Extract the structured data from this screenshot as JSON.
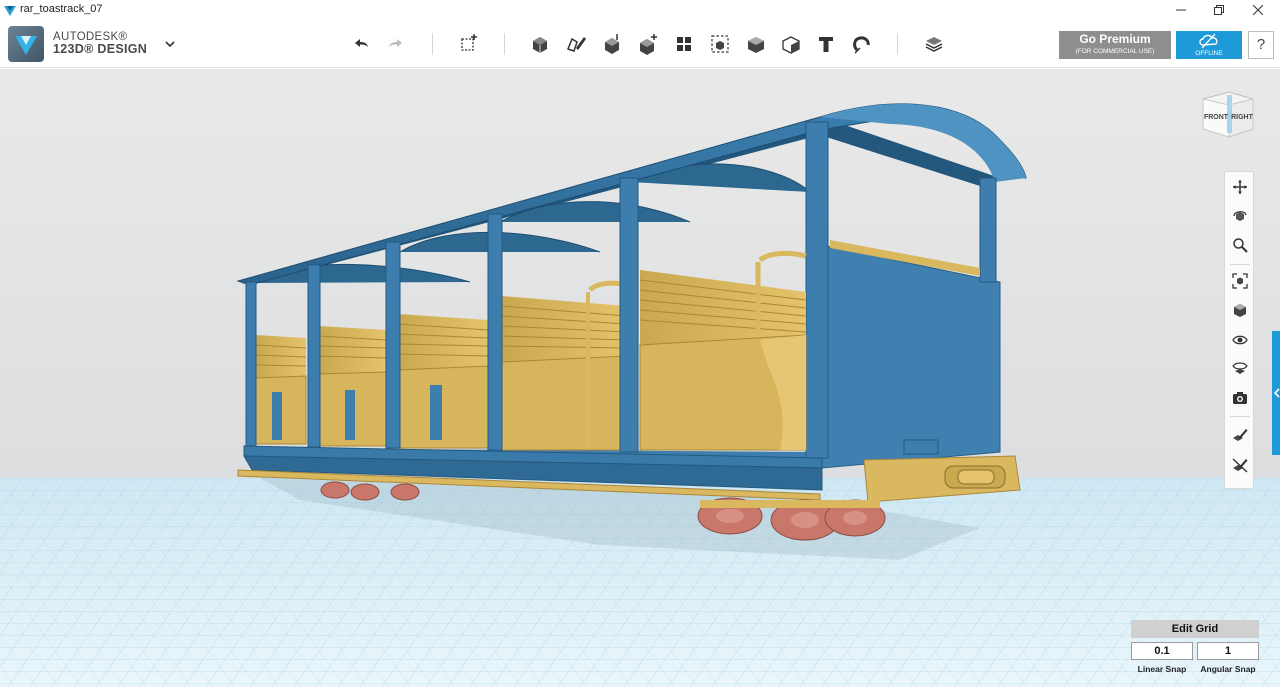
{
  "window": {
    "title": "rar_toastrack_07",
    "controls": [
      "minimize",
      "maximize",
      "close"
    ]
  },
  "app": {
    "brand_line1": "AUTODESK®",
    "brand_line2": "123D® DESIGN"
  },
  "toolbar": {
    "tools": [
      {
        "name": "undo-icon"
      },
      {
        "name": "redo-icon"
      },
      {
        "name": "transform-icon"
      },
      {
        "name": "primitives-icon"
      },
      {
        "name": "sketch-icon"
      },
      {
        "name": "construct-icon"
      },
      {
        "name": "modify-icon"
      },
      {
        "name": "pattern-icon"
      },
      {
        "name": "grouping-icon"
      },
      {
        "name": "combine-icon"
      },
      {
        "name": "measure-icon"
      },
      {
        "name": "text-icon"
      },
      {
        "name": "snap-icon"
      },
      {
        "name": "materials-icon"
      }
    ],
    "premium_label": "Go Premium",
    "premium_sublabel": "(FOR COMMERCIAL USE)",
    "offline_label": "OFFLINE",
    "help_label": "?"
  },
  "viewcube": {
    "front_label": "FRONT",
    "right_label": "RIGHT"
  },
  "navbar": {
    "items": [
      {
        "name": "pan-icon"
      },
      {
        "name": "orbit-icon"
      },
      {
        "name": "zoom-icon"
      },
      {
        "name": "fit-icon"
      },
      {
        "name": "view-mode-icon"
      },
      {
        "name": "visibility-icon"
      },
      {
        "name": "material-view-icon"
      },
      {
        "name": "camera-icon"
      },
      {
        "name": "edit-icon"
      },
      {
        "name": "hide-icon"
      }
    ]
  },
  "grid": {
    "edit_grid_label": "Edit Grid",
    "linear_snap_value": "0.1",
    "angular_snap_value": "1",
    "linear_snap_label": "Linear Snap",
    "angular_snap_label": "Angular Snap"
  },
  "colors": {
    "car_body": "#3d7eae",
    "car_body_dark": "#2b5f86",
    "seats": "#d9b860",
    "wheels": "#c9776a",
    "accent": "#1e9ad9",
    "grid_floor": "#d8edf6"
  }
}
